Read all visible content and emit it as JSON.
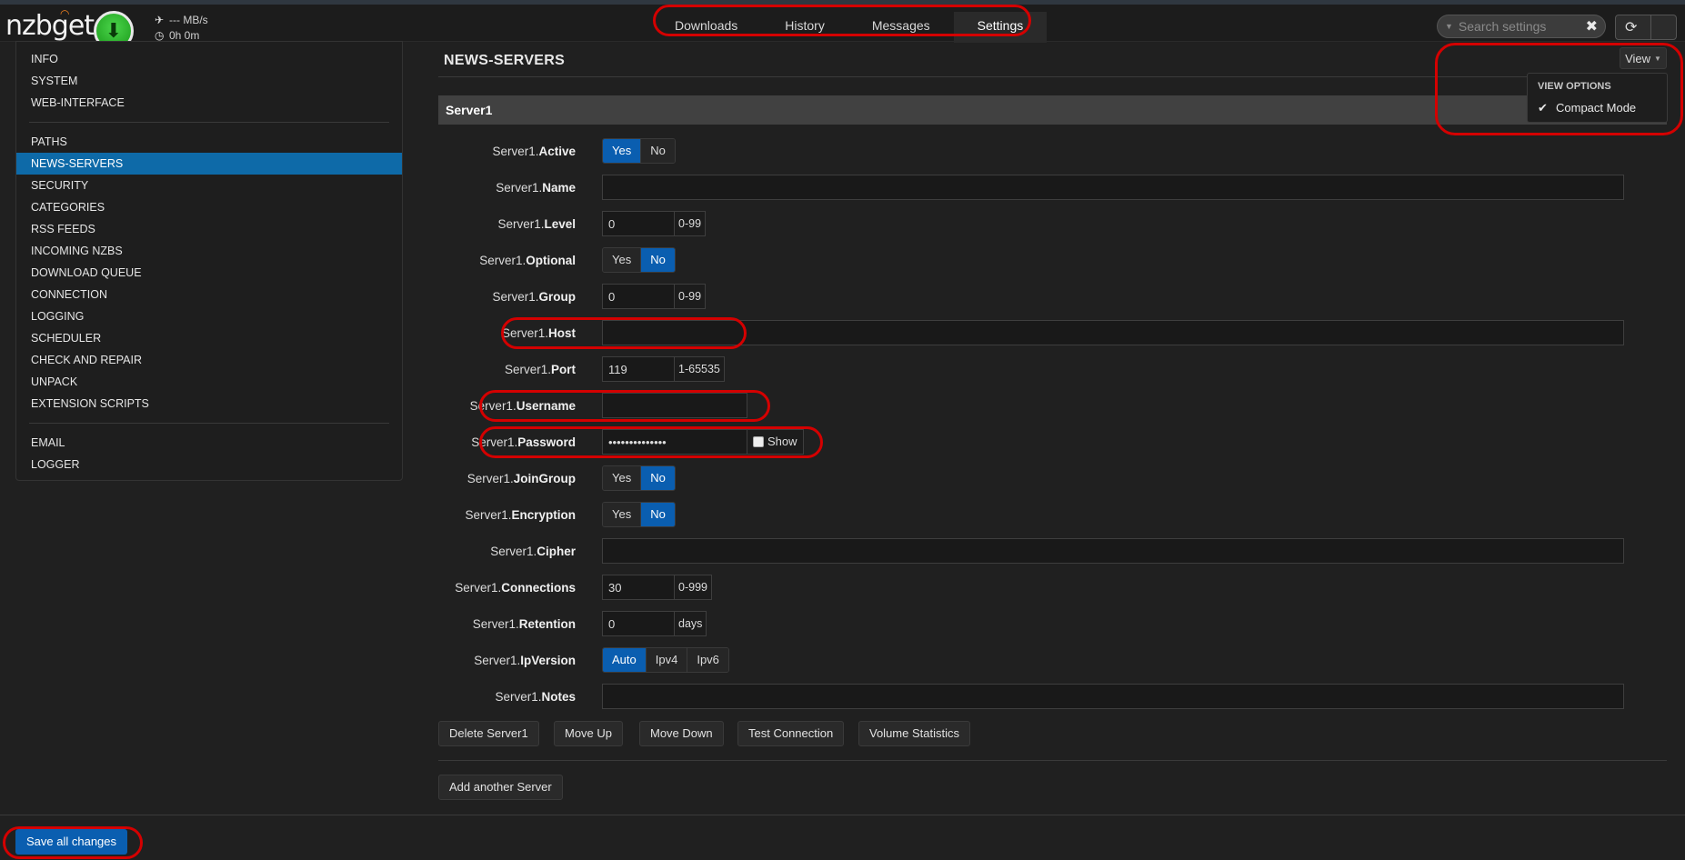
{
  "header": {
    "logo": "nzbget",
    "speed": "--- MB/s",
    "time": "0h 0m",
    "tabs": [
      {
        "label": "Downloads"
      },
      {
        "label": "History"
      },
      {
        "label": "Messages"
      },
      {
        "label": "Settings"
      }
    ],
    "search_placeholder": "Search settings"
  },
  "sidebar": {
    "group1": [
      "INFO",
      "SYSTEM",
      "WEB-INTERFACE"
    ],
    "group2": [
      "PATHS",
      "NEWS-SERVERS",
      "SECURITY",
      "CATEGORIES",
      "RSS FEEDS",
      "INCOMING NZBS",
      "DOWNLOAD QUEUE",
      "CONNECTION",
      "LOGGING",
      "SCHEDULER",
      "CHECK AND REPAIR",
      "UNPACK",
      "EXTENSION SCRIPTS"
    ],
    "group3": [
      "EMAIL",
      "LOGGER"
    ],
    "active": "NEWS-SERVERS"
  },
  "main": {
    "section_title": "NEWS-SERVERS",
    "view_label": "View",
    "view_options_header": "VIEW OPTIONS",
    "compact_mode_label": "Compact Mode",
    "server_title": "Server1",
    "prefix": "Server1.",
    "fields": {
      "active": {
        "name": "Active",
        "options": [
          "Yes",
          "No"
        ],
        "selected": "Yes"
      },
      "name": {
        "name": "Name",
        "value": ""
      },
      "level": {
        "name": "Level",
        "value": "0",
        "range": "0-99"
      },
      "optional": {
        "name": "Optional",
        "options": [
          "Yes",
          "No"
        ],
        "selected": "No"
      },
      "group": {
        "name": "Group",
        "value": "0",
        "range": "0-99"
      },
      "host": {
        "name": "Host",
        "value": ""
      },
      "port": {
        "name": "Port",
        "value": "119",
        "range": "1-65535"
      },
      "username": {
        "name": "Username",
        "value": ""
      },
      "password": {
        "name": "Password",
        "value": "••••••••••••••",
        "show_label": "Show"
      },
      "joingroup": {
        "name": "JoinGroup",
        "options": [
          "Yes",
          "No"
        ],
        "selected": "No"
      },
      "encryption": {
        "name": "Encryption",
        "options": [
          "Yes",
          "No"
        ],
        "selected": "No"
      },
      "cipher": {
        "name": "Cipher",
        "value": ""
      },
      "connections": {
        "name": "Connections",
        "value": "30",
        "range": "0-999"
      },
      "retention": {
        "name": "Retention",
        "value": "0",
        "range": "days"
      },
      "ipversion": {
        "name": "IpVersion",
        "options": [
          "Auto",
          "Ipv4",
          "Ipv6"
        ],
        "selected": "Auto"
      },
      "notes": {
        "name": "Notes",
        "value": ""
      }
    },
    "buttons": {
      "delete": "Delete Server1",
      "move_up": "Move Up",
      "move_down": "Move Down",
      "test": "Test Connection",
      "stats": "Volume Statistics",
      "add": "Add another Server"
    },
    "save_label": "Save all changes"
  },
  "colors": {
    "accent": "#0a5eb0",
    "sidebar_active": "#0e6aa8",
    "highlight": "#d40000"
  }
}
